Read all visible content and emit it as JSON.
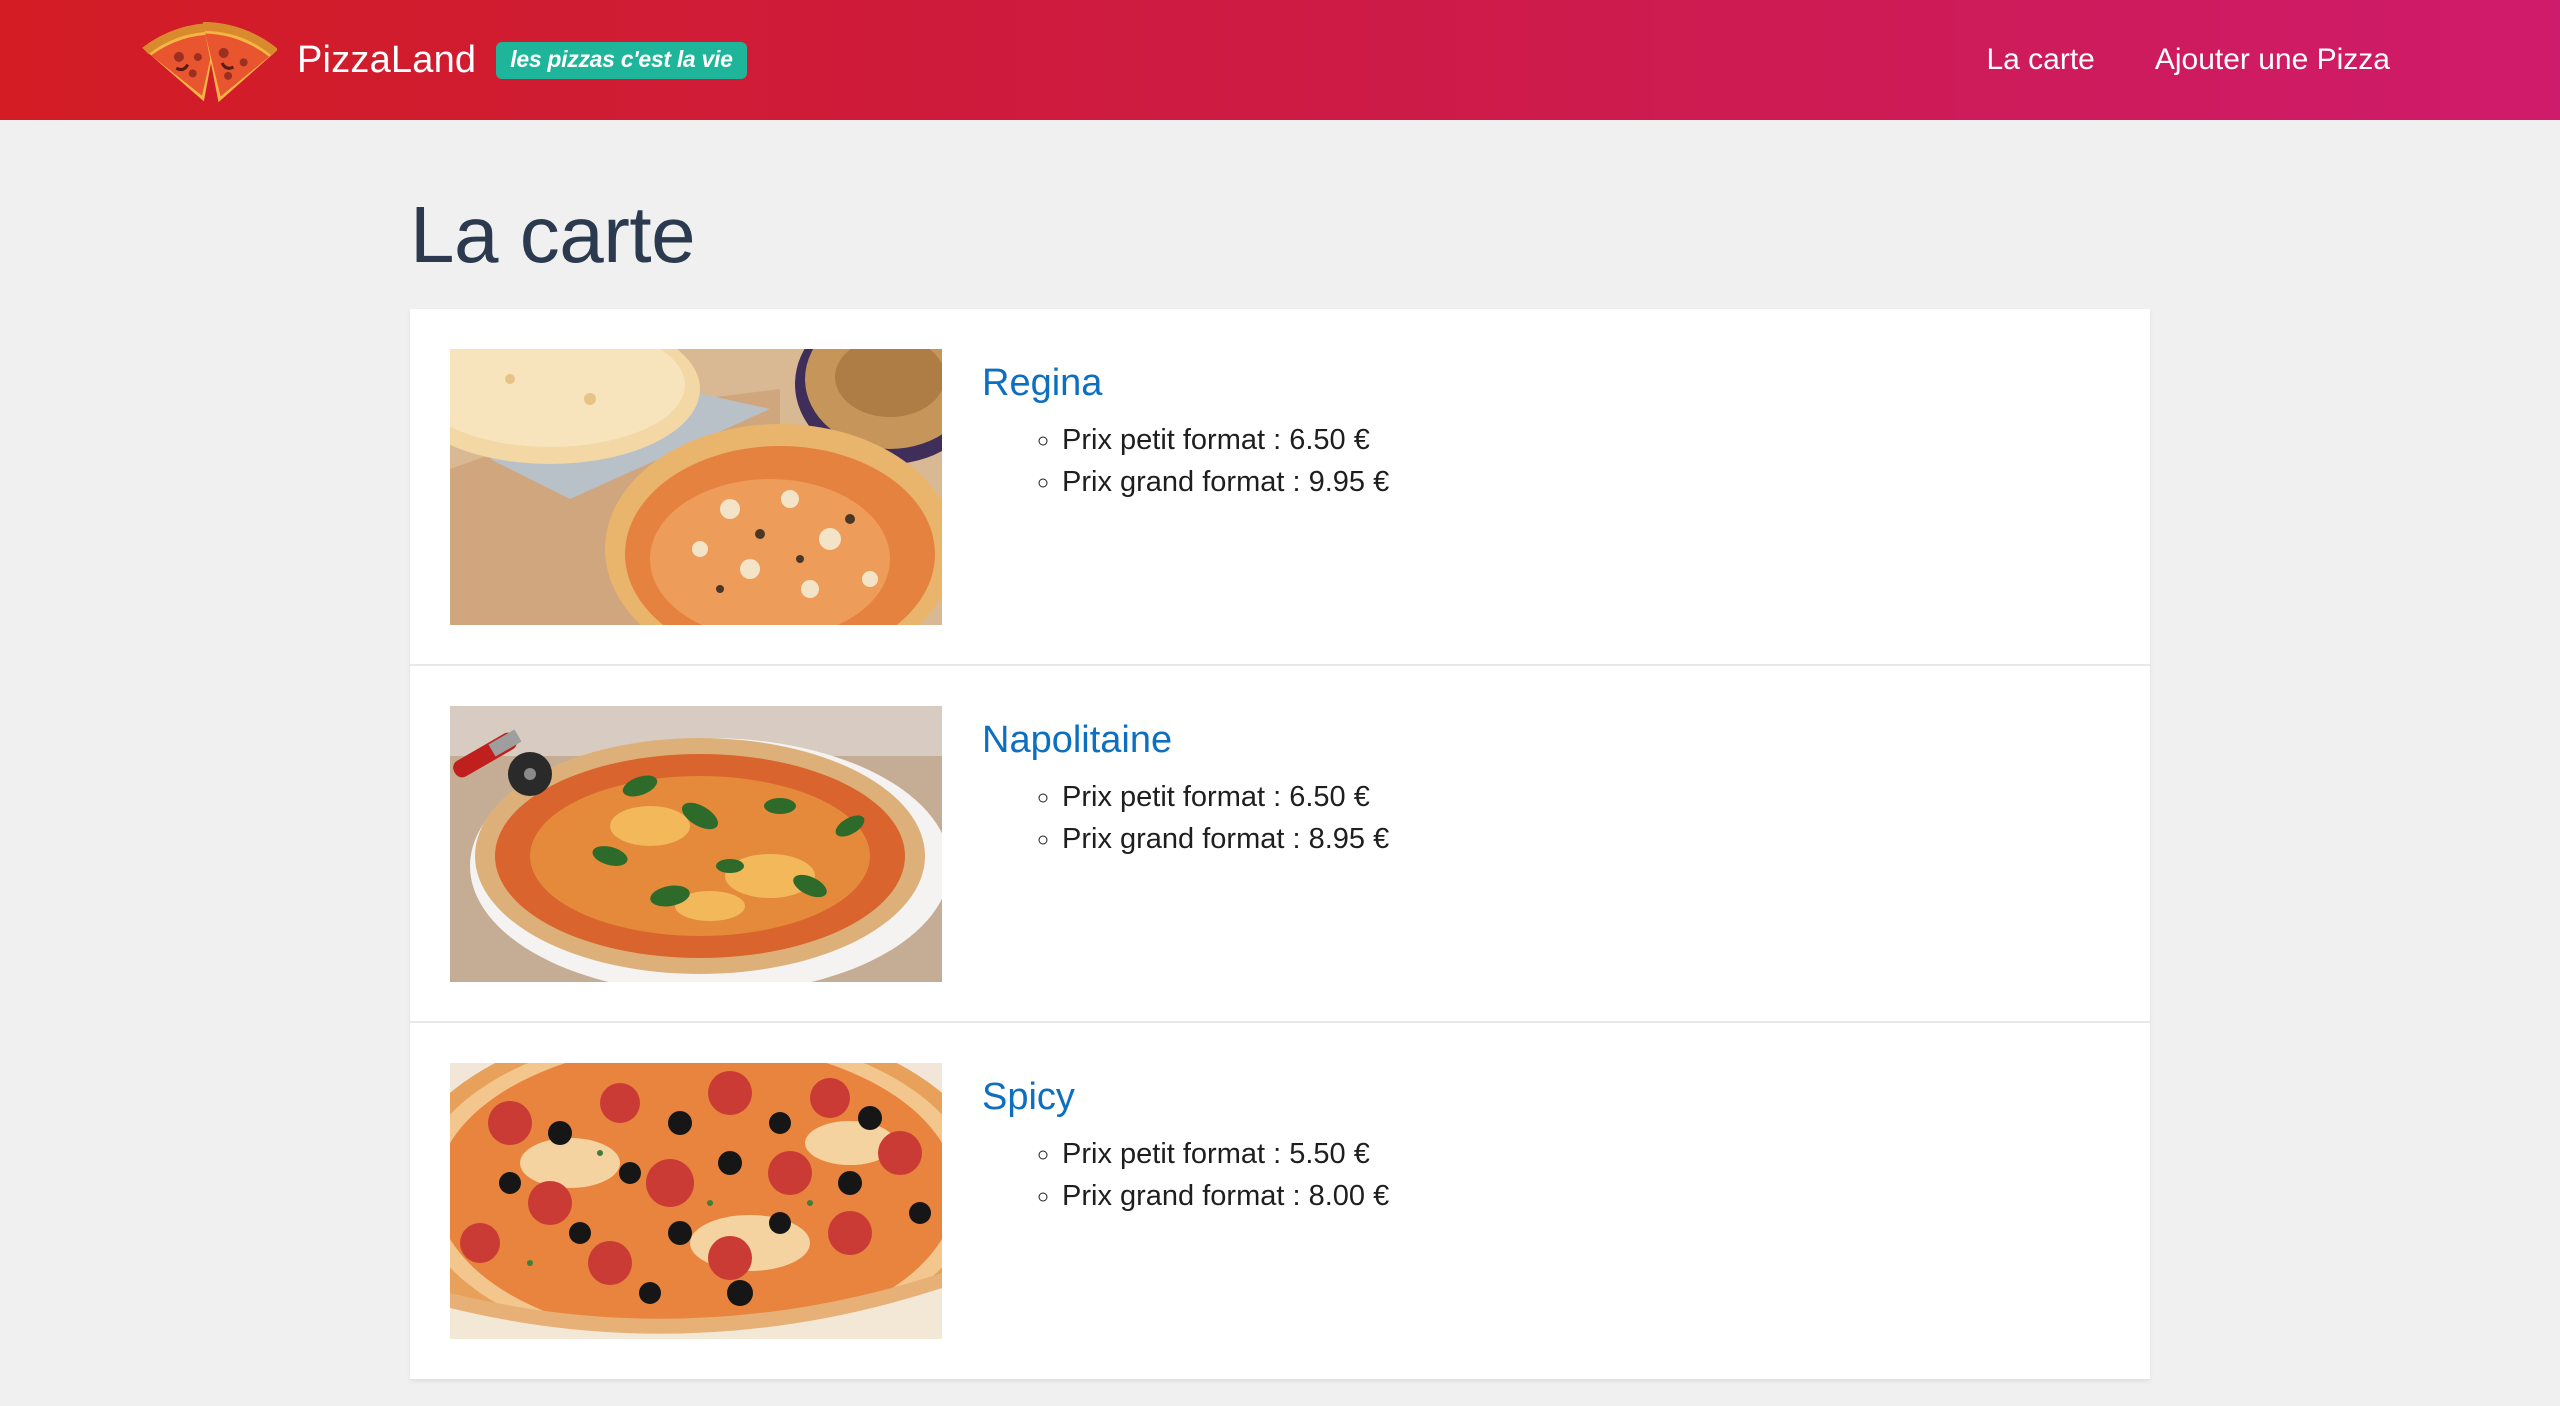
{
  "brand": {
    "name": "PizzaLand",
    "slogan": "les pizzas c'est la vie"
  },
  "nav": {
    "items": [
      {
        "label": "La carte"
      },
      {
        "label": "Ajouter une Pizza"
      }
    ]
  },
  "page": {
    "title": "La carte"
  },
  "pizzas": [
    {
      "name": "Regina",
      "small_price": "Prix petit format : 6.50 €",
      "large_price": "Prix grand format : 9.95 €",
      "image": "pizza-regina-photo"
    },
    {
      "name": "Napolitaine",
      "small_price": "Prix petit format : 6.50 €",
      "large_price": "Prix grand format : 8.95 €",
      "image": "pizza-napolitaine-photo"
    },
    {
      "name": "Spicy",
      "small_price": "Prix petit format : 5.50 €",
      "large_price": "Prix grand format : 8.00 €",
      "image": "pizza-spicy-photo"
    }
  ],
  "colors": {
    "header_gradient_start": "#d31c24",
    "header_gradient_end": "#cf1b6b",
    "slogan_badge": "#1fb59a",
    "pizza_name_link": "#0d6fbf",
    "page_title": "#2b3a4e",
    "page_background": "#f0f0f0"
  }
}
